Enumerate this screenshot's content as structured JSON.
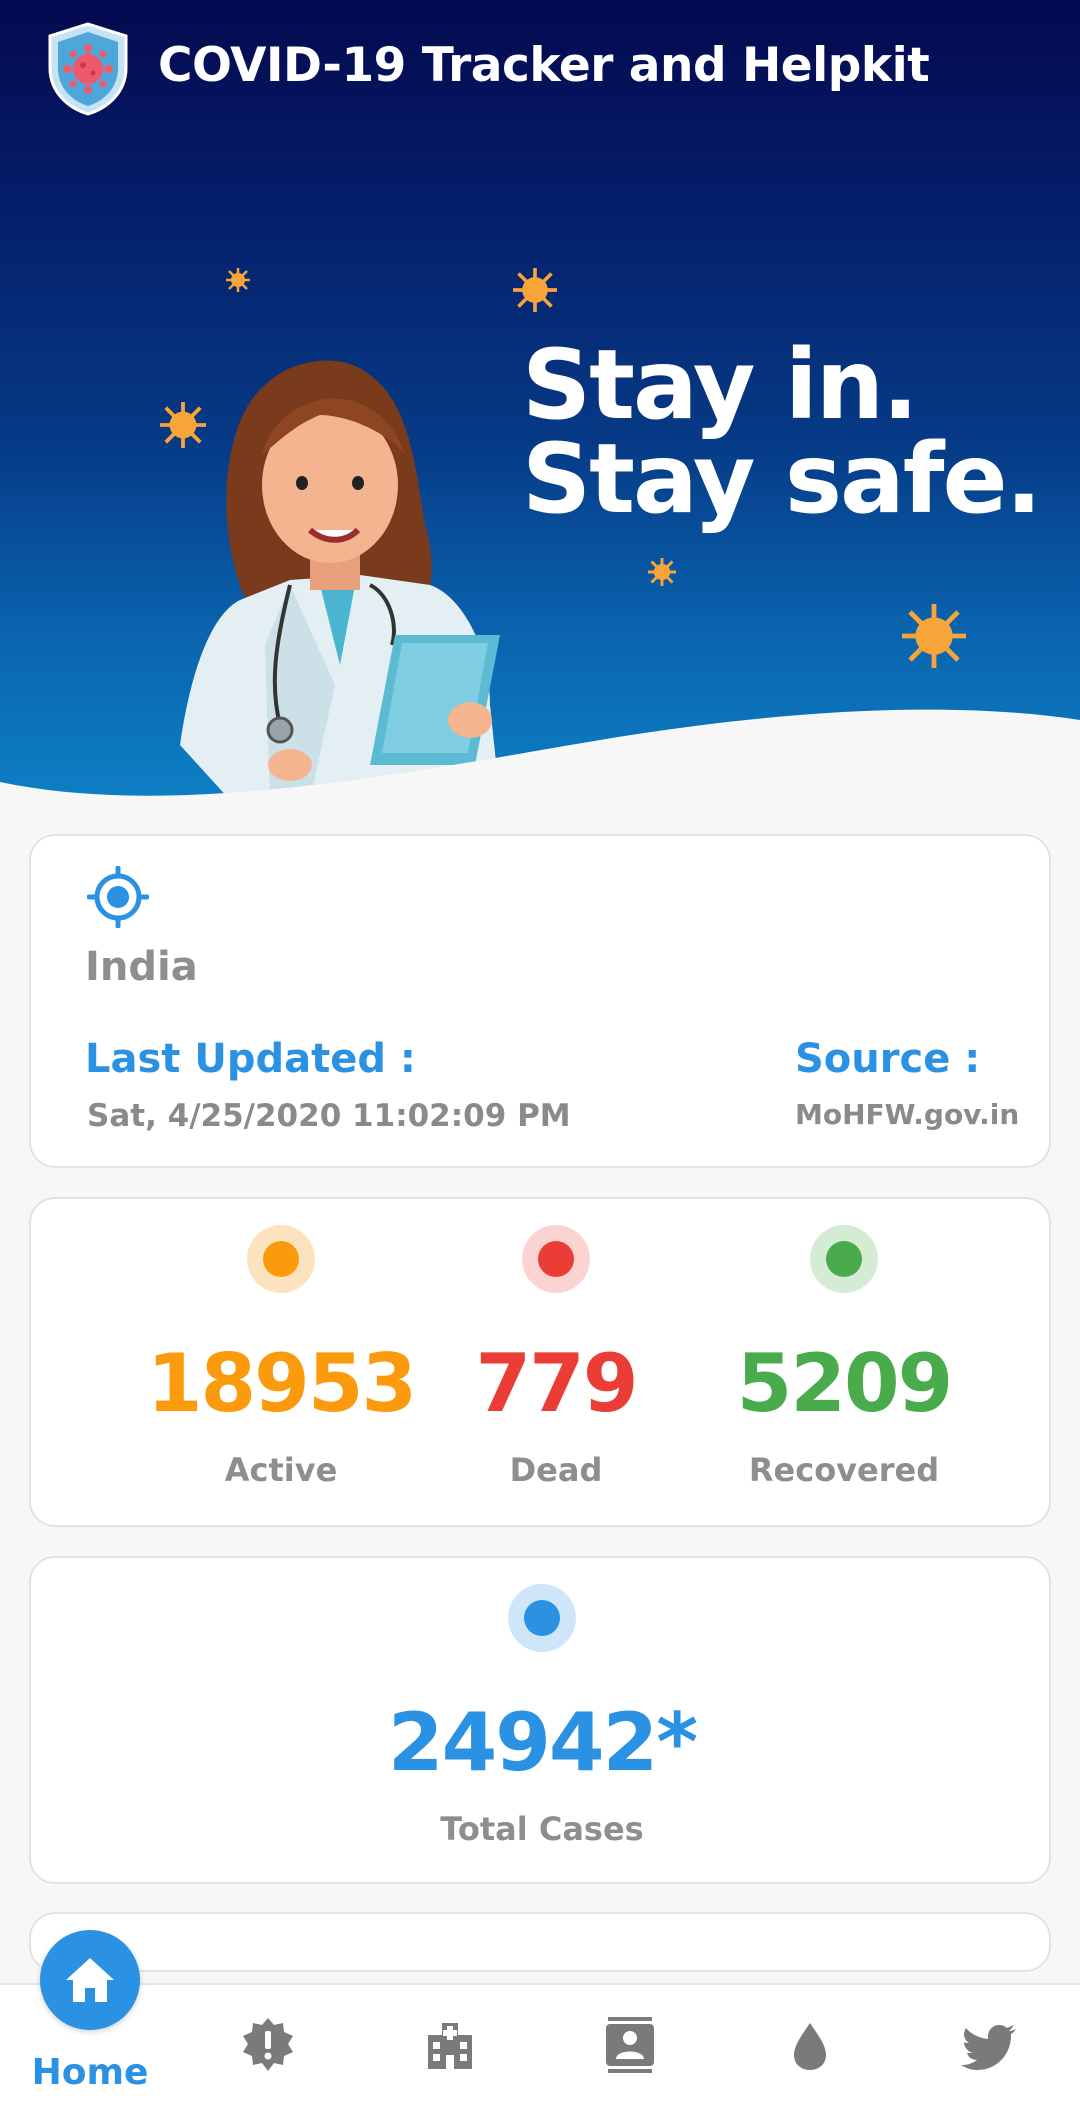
{
  "app": {
    "title": "COVID-19 Tracker and Helpkit",
    "logo_icon": "virus-shield-icon"
  },
  "hero": {
    "line1": "Stay in.",
    "line2": "Stay safe."
  },
  "location": {
    "country": "India",
    "last_updated_label": "Last Updated :",
    "last_updated_value": "Sat, 4/25/2020 11:02:09 PM",
    "source_label": "Source :",
    "source_value": "MoHFW.gov.in",
    "icon": "location-target-icon"
  },
  "stats": {
    "active": {
      "value": "18953",
      "label": "Active",
      "color": "#fb9a0d",
      "ring": "#fde3bd"
    },
    "dead": {
      "value": "779",
      "label": "Dead",
      "color": "#ea3d36",
      "ring": "#fbd3d1"
    },
    "recovered": {
      "value": "5209",
      "label": "Recovered",
      "color": "#4aab4c",
      "ring": "#d4ecd4"
    }
  },
  "total": {
    "value": "24942*",
    "label": "Total Cases",
    "color": "#2a91e3",
    "ring": "#cfe5f9"
  },
  "nav": {
    "home_label": "Home",
    "items": [
      "home-icon",
      "alert-badge-icon",
      "hospital-icon",
      "contacts-icon",
      "blood-drop-icon",
      "twitter-icon"
    ]
  },
  "colors": {
    "accent": "#2a91e3",
    "header_dark": "#04094f"
  }
}
